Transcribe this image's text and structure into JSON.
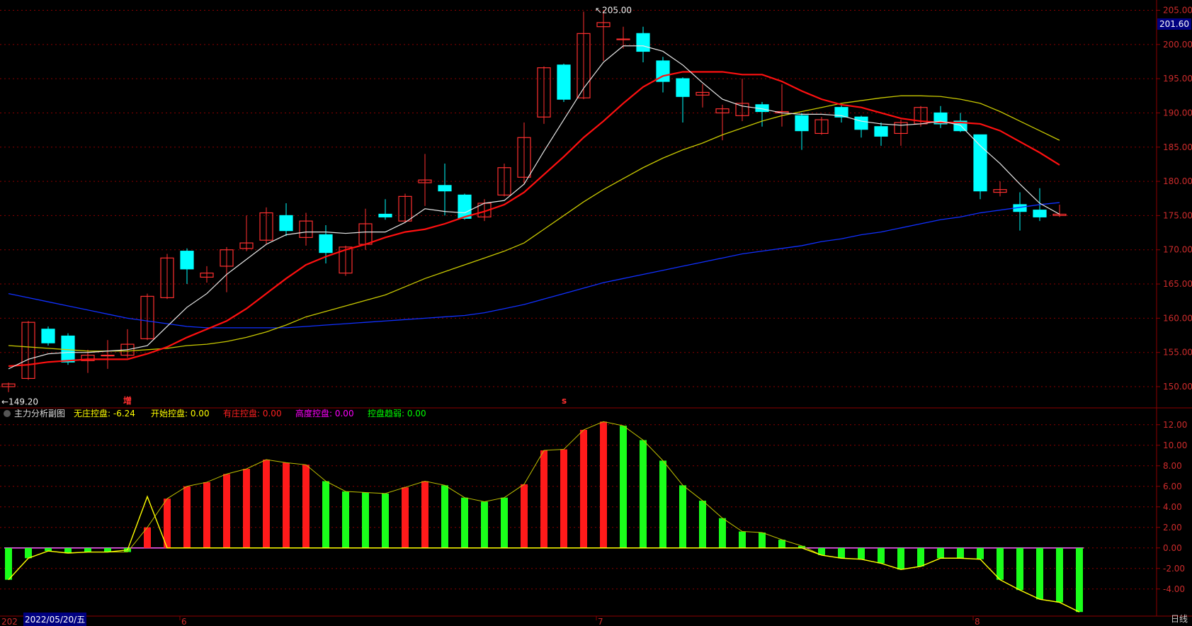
{
  "colors": {
    "bg": "#000000",
    "up": "#ff3030",
    "down": "#00ffff",
    "grid": "#8b0000",
    "ma_white": "#e8e8e8",
    "ma_red": "#ff1010",
    "ma_yellow": "#c8c800",
    "ma_blue": "#1030ff",
    "macd_up": "#ff1a1a",
    "macd_down": "#1aff1a",
    "axis_text": "#cc2b2b"
  },
  "main_panel": {
    "price_axis_ticks": [
      "205.00",
      "200.00",
      "195.00",
      "190.00",
      "185.00",
      "180.00",
      "175.00",
      "170.00",
      "165.00",
      "160.00",
      "155.00",
      "150.00"
    ],
    "current_price_tag": "201.60",
    "high_label": "205.00",
    "low_label": "149.20",
    "markers": [
      "增",
      "s"
    ]
  },
  "sub_panel": {
    "title": "主力分析副图",
    "indicators": [
      {
        "label": "无庄控盘:",
        "value": "-6.24",
        "color": "#ffff00"
      },
      {
        "label": "开始控盘:",
        "value": "0.00",
        "color": "#ffff00"
      },
      {
        "label": "有庄控盘:",
        "value": "0.00",
        "color": "#ff2020"
      },
      {
        "label": "高度控盘:",
        "value": "0.00",
        "color": "#ff00ff"
      },
      {
        "label": "控盘趋弱:",
        "value": "0.00",
        "color": "#00ff00"
      }
    ],
    "axis_ticks": [
      "12.00",
      "10.00",
      "8.00",
      "6.00",
      "4.00",
      "2.00",
      "0.00",
      "-2.00",
      "-4.00"
    ]
  },
  "x_axis": {
    "left_label": "202",
    "cursor_date": "2022/05/20/五",
    "month_labels": [
      "6",
      "7",
      "8"
    ]
  },
  "status": {
    "period": "日线"
  },
  "chart_data": {
    "type": "candlestick",
    "ylim": [
      147,
      206.5
    ],
    "candles": [
      [
        150.0,
        150.4,
        149.2,
        150.6
      ],
      [
        151.2,
        159.4,
        151.0,
        159.6
      ],
      [
        158.4,
        156.4,
        156.0,
        158.8
      ],
      [
        157.4,
        153.6,
        153.2,
        157.8
      ],
      [
        153.8,
        154.6,
        152.0,
        155.4
      ],
      [
        154.6,
        154.6,
        152.6,
        156.8
      ],
      [
        154.6,
        156.2,
        154.2,
        158.4
      ],
      [
        157.0,
        163.2,
        156.8,
        163.6
      ],
      [
        163.0,
        168.8,
        162.8,
        169.4
      ],
      [
        169.8,
        167.2,
        165.0,
        170.2
      ],
      [
        166.0,
        166.6,
        165.2,
        167.6
      ],
      [
        167.6,
        170.0,
        163.8,
        170.4
      ],
      [
        170.2,
        171.0,
        169.8,
        175.0
      ],
      [
        171.4,
        175.4,
        170.8,
        176.2
      ],
      [
        175.0,
        172.8,
        172.0,
        176.8
      ],
      [
        171.8,
        174.2,
        170.6,
        175.4
      ],
      [
        172.2,
        169.6,
        168.0,
        173.6
      ],
      [
        166.6,
        170.4,
        166.2,
        170.6
      ],
      [
        170.8,
        173.8,
        170.0,
        176.0
      ],
      [
        175.2,
        174.8,
        174.4,
        177.4
      ],
      [
        174.2,
        177.8,
        174.0,
        178.2
      ],
      [
        179.8,
        180.2,
        176.4,
        184.0
      ],
      [
        179.4,
        178.6,
        175.0,
        182.6
      ],
      [
        178.0,
        174.6,
        174.4,
        178.2
      ],
      [
        174.8,
        176.8,
        174.2,
        177.4
      ],
      [
        178.0,
        182.0,
        177.8,
        182.6
      ],
      [
        180.6,
        186.4,
        179.6,
        188.6
      ],
      [
        189.4,
        196.6,
        188.4,
        196.8
      ],
      [
        197.0,
        192.0,
        191.6,
        197.2
      ],
      [
        192.2,
        201.6,
        192.0,
        204.8
      ],
      [
        202.6,
        203.2,
        197.6,
        205.0
      ],
      [
        200.8,
        200.8,
        199.4,
        202.6
      ],
      [
        201.6,
        199.0,
        197.4,
        202.6
      ],
      [
        197.6,
        194.6,
        193.0,
        198.2
      ],
      [
        195.0,
        192.4,
        188.6,
        195.2
      ],
      [
        192.6,
        193.0,
        190.8,
        194.2
      ],
      [
        190.0,
        190.6,
        186.0,
        191.2
      ],
      [
        189.6,
        191.4,
        188.8,
        195.0
      ],
      [
        191.2,
        190.2,
        188.0,
        191.6
      ],
      [
        190.0,
        190.2,
        188.0,
        194.2
      ],
      [
        189.6,
        187.4,
        184.6,
        190.0
      ],
      [
        187.0,
        189.0,
        186.8,
        189.4
      ],
      [
        190.8,
        189.4,
        188.6,
        191.2
      ],
      [
        189.4,
        187.6,
        186.4,
        189.6
      ],
      [
        188.0,
        186.6,
        185.2,
        188.6
      ],
      [
        187.0,
        188.6,
        185.2,
        189.0
      ],
      [
        188.4,
        190.8,
        188.0,
        191.0
      ],
      [
        190.0,
        188.4,
        187.8,
        191.0
      ],
      [
        188.8,
        187.4,
        187.2,
        190.0
      ],
      [
        186.8,
        178.6,
        177.4,
        186.8
      ],
      [
        178.4,
        178.8,
        177.8,
        180.0
      ],
      [
        176.6,
        175.6,
        172.8,
        178.4
      ],
      [
        175.8,
        174.8,
        174.2,
        179.0
      ],
      [
        175.0,
        175.2,
        174.8,
        176.6
      ]
    ],
    "ma_white": [
      152.6,
      154.0,
      154.8,
      155.0,
      155.0,
      155.2,
      155.4,
      156.0,
      158.8,
      161.6,
      163.6,
      166.4,
      168.6,
      170.8,
      172.2,
      172.6,
      172.6,
      172.4,
      172.6,
      172.6,
      174.0,
      176.0,
      175.6,
      175.4,
      176.8,
      177.2,
      179.6,
      184.4,
      189.0,
      193.6,
      197.4,
      199.8,
      199.8,
      199.0,
      197.0,
      194.4,
      192.0,
      191.0,
      190.6,
      190.0,
      189.8,
      189.8,
      189.6,
      188.8,
      188.4,
      188.2,
      188.4,
      188.8,
      188.2,
      185.2,
      182.6,
      179.6,
      176.8,
      175.2
    ],
    "ma_red": [
      153.0,
      153.2,
      153.6,
      153.8,
      154.0,
      154.0,
      154.0,
      154.8,
      155.8,
      157.2,
      158.4,
      159.6,
      161.4,
      163.6,
      165.8,
      167.8,
      169.0,
      170.0,
      170.8,
      171.8,
      172.6,
      173.0,
      173.8,
      174.8,
      175.6,
      176.6,
      178.4,
      181.0,
      183.6,
      186.4,
      188.8,
      191.4,
      193.8,
      195.4,
      196.0,
      196.0,
      196.0,
      195.6,
      195.6,
      194.6,
      193.2,
      192.0,
      191.2,
      190.8,
      190.0,
      189.2,
      188.8,
      188.6,
      188.6,
      188.4,
      187.4,
      185.8,
      184.2,
      182.4
    ],
    "ma_yellow": [
      156.0,
      155.8,
      155.6,
      155.4,
      155.2,
      155.2,
      155.2,
      155.4,
      155.6,
      156.0,
      156.2,
      156.6,
      157.2,
      158.0,
      159.0,
      160.2,
      161.0,
      161.8,
      162.6,
      163.4,
      164.6,
      165.8,
      166.8,
      167.8,
      168.8,
      169.8,
      171.0,
      173.0,
      175.0,
      177.0,
      178.8,
      180.4,
      182.0,
      183.4,
      184.6,
      185.6,
      186.8,
      187.8,
      188.8,
      189.6,
      190.2,
      190.8,
      191.4,
      191.8,
      192.2,
      192.5,
      192.5,
      192.4,
      192.0,
      191.4,
      190.2,
      188.8,
      187.4,
      186.0
    ],
    "ma_blue": [
      163.6,
      163.0,
      162.4,
      161.8,
      161.2,
      160.6,
      160.0,
      159.6,
      159.2,
      158.8,
      158.6,
      158.6,
      158.6,
      158.6,
      158.6,
      158.8,
      159.0,
      159.2,
      159.4,
      159.6,
      159.8,
      160.0,
      160.2,
      160.4,
      160.8,
      161.4,
      162.0,
      162.8,
      163.6,
      164.4,
      165.2,
      165.8,
      166.4,
      167.0,
      167.6,
      168.2,
      168.8,
      169.4,
      169.8,
      170.2,
      170.6,
      171.2,
      171.6,
      172.2,
      172.6,
      173.2,
      173.8,
      174.4,
      174.8,
      175.4,
      175.8,
      176.2,
      176.6,
      176.9
    ],
    "sub": {
      "ylim": [
        -6.5,
        13.5
      ],
      "values": [
        -3.1,
        -1.0,
        -0.3,
        -0.5,
        -0.4,
        -0.4,
        -0.4,
        2.0,
        4.8,
        6.0,
        6.4,
        7.2,
        7.7,
        8.6,
        8.3,
        8.1,
        6.5,
        5.5,
        5.4,
        5.3,
        5.9,
        6.5,
        6.1,
        4.9,
        4.5,
        4.9,
        6.2,
        9.5,
        9.6,
        11.5,
        12.3,
        11.9,
        10.5,
        8.5,
        6.1,
        4.6,
        2.9,
        1.6,
        1.5,
        0.8,
        0.2,
        -0.7,
        -1.0,
        -1.1,
        -1.5,
        -2.1,
        -1.8,
        -1.0,
        -1.0,
        -1.1,
        -3.1,
        -4.1,
        -5.0,
        -5.3,
        -6.24
      ],
      "yellow_line": [
        -3.1,
        -1.0,
        -0.3,
        -0.5,
        -0.4,
        -0.4,
        -0.2,
        5.0,
        0.0,
        0.0,
        0.0,
        0.0,
        0.0,
        0.0,
        0.0,
        0.0,
        0.0,
        0.0,
        0.0,
        0.0,
        0.0,
        0.0,
        0.0,
        0.0,
        0.0,
        0.0,
        0.0,
        0.0,
        0.0,
        0.0,
        0.0,
        0.0,
        0.0,
        0.0,
        0.0,
        0.0,
        0.0,
        0.0,
        0.0,
        0.0,
        0.0,
        -0.7,
        -1.0,
        -1.1,
        -1.5,
        -2.1,
        -1.8,
        -1.0,
        -1.0,
        -1.1,
        -3.1,
        -4.1,
        -5.0,
        -5.3,
        -6.24
      ]
    }
  }
}
